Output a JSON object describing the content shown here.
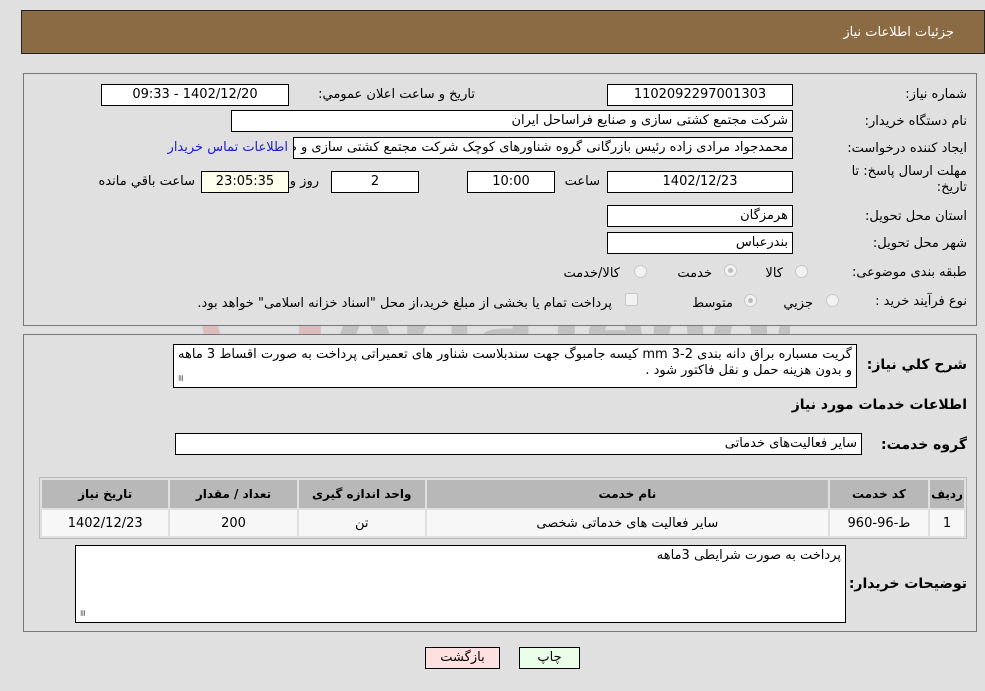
{
  "header": {
    "title": "جزئیات اطلاعات نیاز"
  },
  "info": {
    "need_number_label": "شماره نیاز:",
    "need_number": "1102092297001303",
    "announce_label": "تاریخ و ساعت اعلان عمومي:",
    "announce_value": "1402/12/20 - 09:33",
    "buyer_org_label": "نام دستگاه خریدار:",
    "buyer_org": "شرکت مجتمع کشتی سازی و صنایع فراساحل ایران",
    "creator_label": "ایجاد کننده درخواست:",
    "creator": "محمدجواد مرادی زاده رئیس بازرگانی گروه شناورهای کوچک  شرکت مجتمع کشتی سازی و صنایع فراساحل ایران",
    "contact_link": "اطلاعات تماس خریدار",
    "deadline_label_line1": "مهلت ارسال پاسخ: تا",
    "deadline_label_line2": "تاریخ:",
    "deadline_date": "1402/12/23",
    "time_label": "ساعت",
    "deadline_time": "10:00",
    "days_value": "2",
    "days_label": "روز و",
    "remaining_time": "23:05:35",
    "remaining_label": "ساعت باقي مانده",
    "province_label": "استان محل تحویل:",
    "province": "هرمزگان",
    "city_label": "شهر محل تحویل:",
    "city": "بندرعباس",
    "category_label": "طبقه بندی موضوعی:",
    "category_options": [
      "کالا",
      "خدمت",
      "کالا/خدمت"
    ],
    "category_selected": "خدمت",
    "process_label": "نوع فرآیند خرید :",
    "process_options": [
      "جزیي",
      "متوسط"
    ],
    "process_selected": "متوسط",
    "treasury_note": "پرداخت تمام یا بخشی از مبلغ خرید،از محل \"اسناد خزانه اسلامی\" خواهد بود."
  },
  "description": {
    "label": "شرح کلي نیاز:",
    "text": "گریت مسباره براق دانه بندی mm 3-2 کیسه جامبوگ جهت سندبلاست شناور های تعمیراتی پرداخت به صورت اقساط 3 ماهه و بدون هزینه حمل و نقل فاکتور شود ."
  },
  "services": {
    "section_title": "اطلاعات خدمات مورد نیاز",
    "group_label": "گروه خدمت:",
    "group_value": "سایر فعالیت‌های خدماتی",
    "columns": [
      "ردیف",
      "کد خدمت",
      "نام خدمت",
      "واحد اندازه گیری",
      "تعداد / مقدار",
      "تاریخ نیاز"
    ],
    "rows": [
      [
        "1",
        "ط-96-960",
        "سایر فعالیت های خدماتی شخصی",
        "تن",
        "200",
        "1402/12/23"
      ]
    ]
  },
  "buyer_notes": {
    "label": "توضیحات خریدار:",
    "text": "پرداخت به صورت شرایطی 3ماهه"
  },
  "buttons": {
    "print": "چاپ",
    "back": "بازگشت"
  },
  "colors": {
    "header_bg": "#8b6b43",
    "print_bg": "#eaffea",
    "back_bg": "#ffe0e0"
  },
  "watermark": "AriaTender.neT"
}
